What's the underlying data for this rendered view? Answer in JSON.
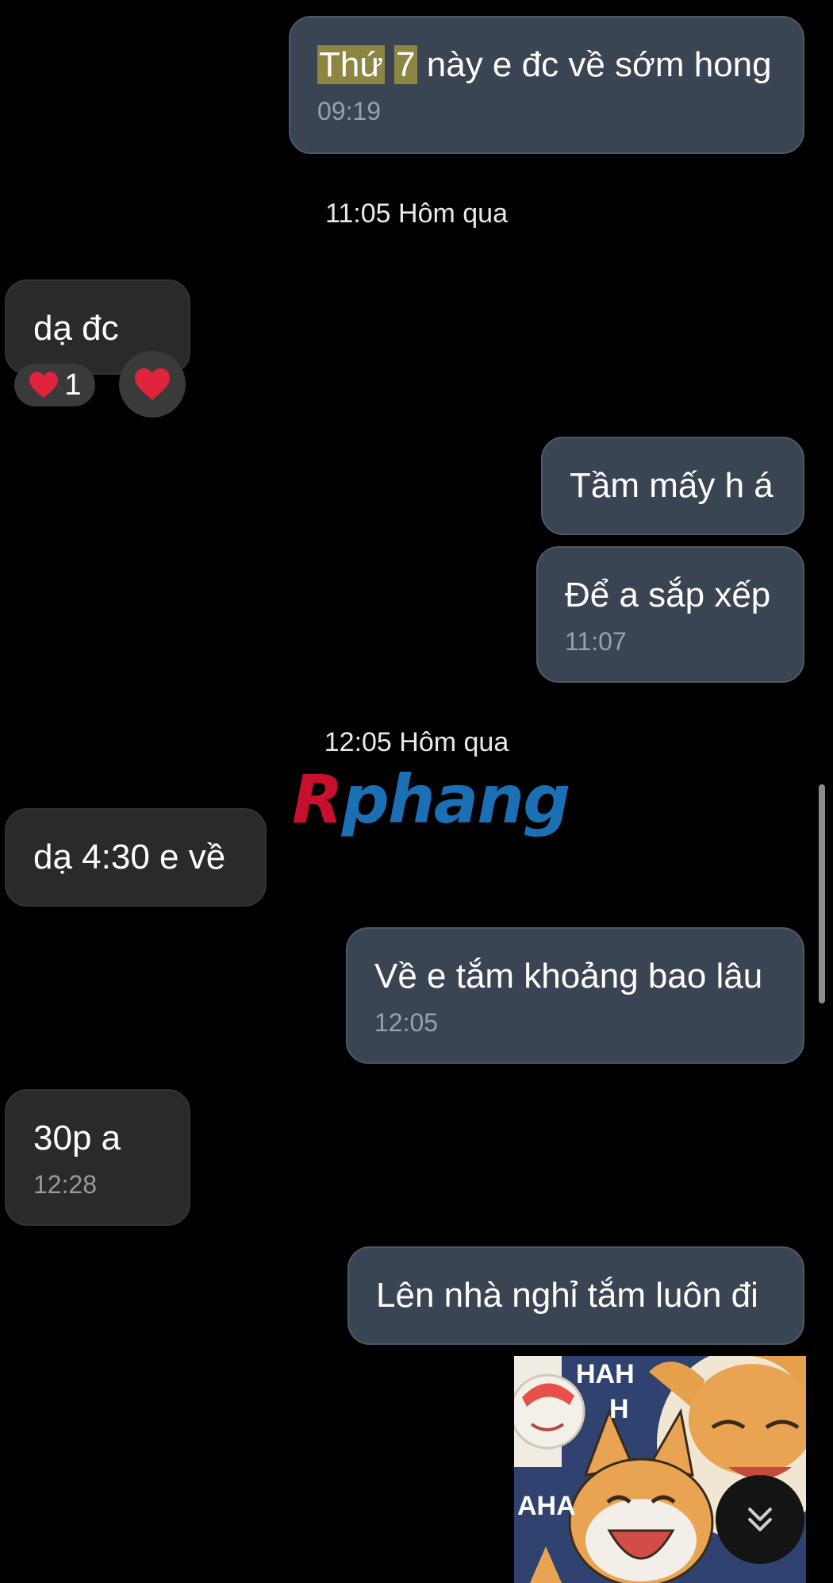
{
  "messages": [
    {
      "direction": "out",
      "parts": [
        {
          "text": "Thứ",
          "hl": true
        },
        {
          "text": " ",
          "hl": false
        },
        {
          "text": "7",
          "hl": true
        },
        {
          "text": " này e đc về sớm hong",
          "hl": false
        }
      ],
      "time": "09:19"
    },
    {
      "direction": "in",
      "text": "dạ đc",
      "reaction_count": "1"
    },
    {
      "direction": "out",
      "text": "Tầm mấy h á"
    },
    {
      "direction": "out",
      "text": "Để a sắp xếp",
      "time": "11:07"
    },
    {
      "direction": "in",
      "text": "dạ 4:30 e về"
    },
    {
      "direction": "out",
      "text": "Về e tắm khoảng bao lâu",
      "time": "12:05"
    },
    {
      "direction": "in",
      "text": "30p a",
      "time": "12:28"
    },
    {
      "direction": "out",
      "text": "Lên nhà nghỉ tắm luôn đi"
    }
  ],
  "separators": [
    "11:05 Hôm qua",
    "12:05 Hôm qua"
  ],
  "watermark": {
    "first": "R",
    "rest": "phang"
  },
  "sticker": {
    "text1": "HAH",
    "text2": "H",
    "text3": "AHA"
  },
  "icons": {
    "heart": "heart-icon",
    "scroll": "chevron-double-down-icon"
  },
  "colors": {
    "outgoing_bubble": "#3a4452",
    "incoming_bubble": "#2a2a2a",
    "highlight": "#8c8642",
    "heart": "#e0243c"
  }
}
